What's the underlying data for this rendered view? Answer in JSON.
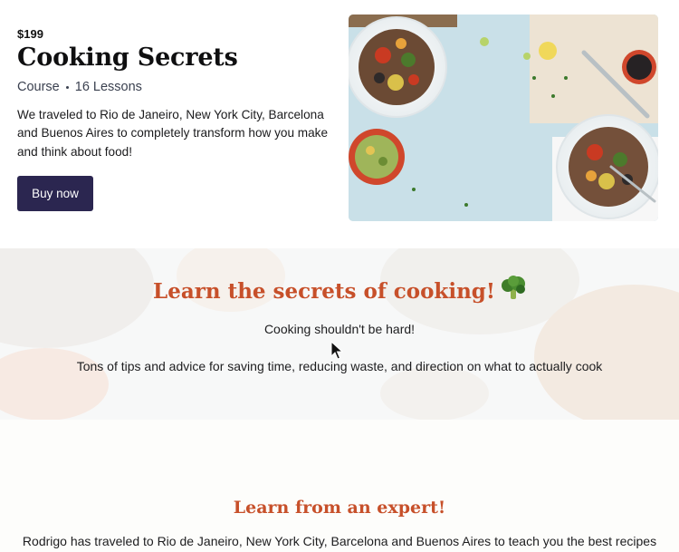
{
  "hero": {
    "price": "$199",
    "title": "Cooking Secrets",
    "meta_type": "Course",
    "meta_lessons": "16 Lessons",
    "description": "We traveled to Rio de Janeiro, New York City, Barcelona and Buenos Aires to completely transform how you make and think about food!",
    "buy_label": "Buy now"
  },
  "secrets": {
    "heading": "Learn the secrets of cooking!",
    "subheading": "Cooking shouldn't be hard!",
    "tips": "Tons of tips and advice for saving time, reducing waste, and direction on what to actually cook"
  },
  "expert": {
    "heading": "Learn from an expert!",
    "text": "Rodrigo has traveled to Rio de Janeiro, New York City, Barcelona and Buenos Aires to teach you the best recipes"
  },
  "colors": {
    "accent": "#c7502a",
    "button": "#2b2650"
  }
}
